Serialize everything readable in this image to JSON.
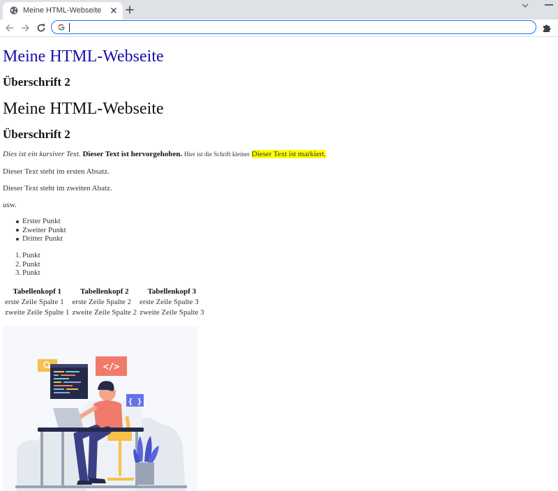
{
  "browser": {
    "tab_title": "Meine HTML-Webseite",
    "address_value": ""
  },
  "page": {
    "link_heading": "Meine HTML-Webseite",
    "subheading_1": "Überschrift 2",
    "heading": "Meine HTML-Webseite",
    "subheading_2": "Überschrift 2",
    "formatting": {
      "italic": "Dies ist ein kursiver Text.",
      "bold": "Dieser Text ist hervorgehoben.",
      "small": "Hier ist die Schrift kleiner",
      "marked": "Dieser Text ist markiert."
    },
    "paragraph_1": "Dieser Text steht im ersten Absatz.",
    "paragraph_2": "Dieser Text steht im zweiten Abatz.",
    "paragraph_3": "usw.",
    "unordered_list": [
      "Erster Punkt",
      "Zweiter Punkt",
      "Dritter Punkt"
    ],
    "ordered_list": {
      "numbers": [
        "1.",
        "2.",
        "3."
      ],
      "items": [
        "Punkt",
        "Punkt",
        "Punkt"
      ]
    },
    "table": {
      "headers": [
        "Tabellenkopf 1",
        "Tabellenkopf 2",
        "Tabellenkopf 3"
      ],
      "rows": [
        [
          "erste Zeile Spalte 1",
          "erste Zeile Spalte 2",
          "erste Zeile Spalte 3"
        ],
        [
          "zweite Zeile Spalte 1",
          "zweite Zeile Spalte 2",
          "zweite Zeile Spalte 3"
        ]
      ]
    },
    "illustration": {
      "code_tag": "</>",
      "braces_tag": "{ }"
    }
  },
  "colors": {
    "link": "#1a0dab",
    "mark": "#ffff00",
    "omnibox_focus": "#1a73e8",
    "tab_strip": "#dee1e6"
  }
}
